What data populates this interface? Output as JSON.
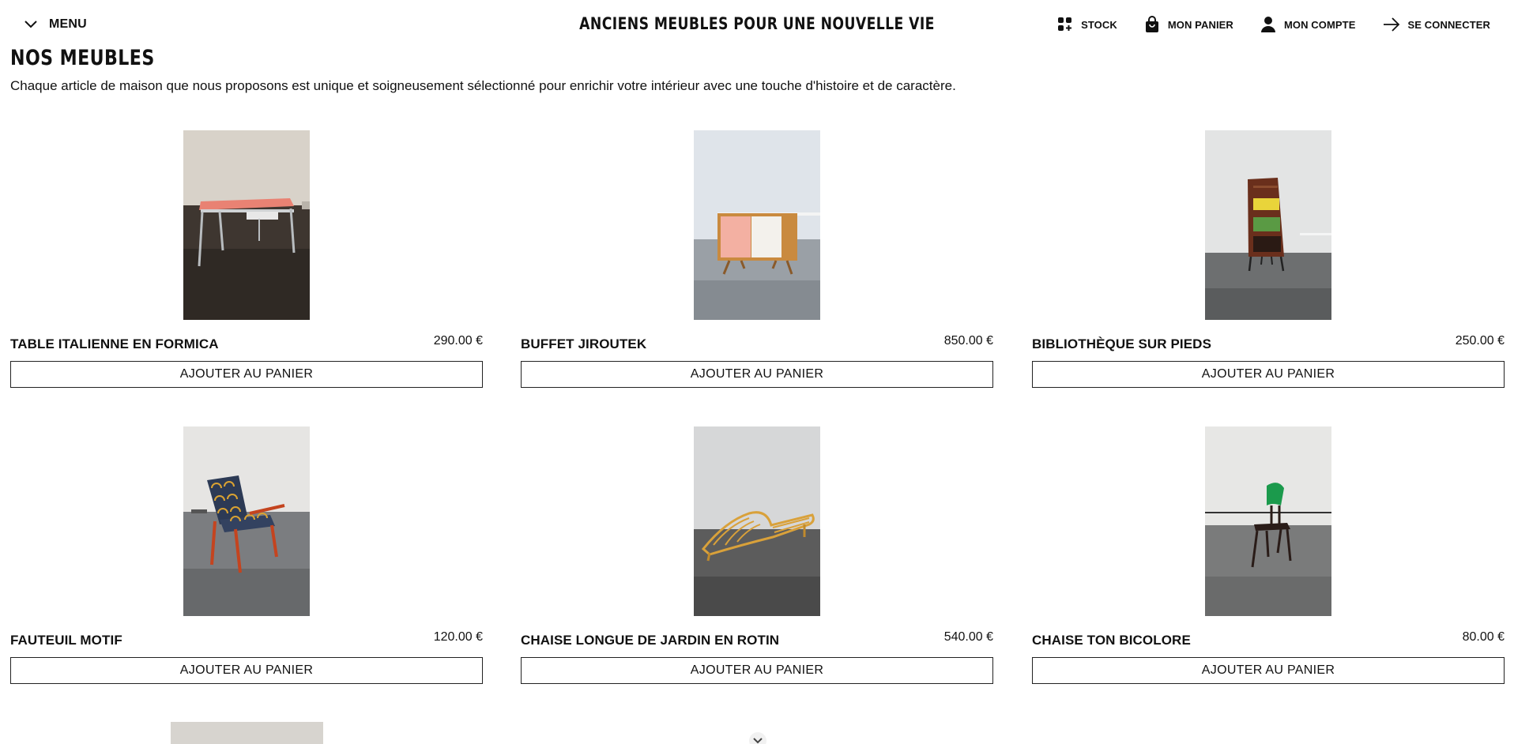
{
  "header": {
    "menu_label": "MENU",
    "site_title": "ANCIENS MEUBLES POUR UNE NOUVELLE VIE",
    "nav": {
      "stock": "STOCK",
      "cart": "MON PANIER",
      "account": "MON COMPTE",
      "login": "SE CONNECTER"
    }
  },
  "main": {
    "title": "NOS MEUBLES",
    "intro": "Chaque article de maison que nous proposons est unique et soigneusement sélectionné pour enrichir votre intérieur avec une touche d'histoire et de caractère."
  },
  "products": [
    {
      "name": "TABLE ITALIENNE EN FORMICA",
      "price": "290.00 €",
      "button": "AJOUTER AU PANIER",
      "image": "formica-desk-photo"
    },
    {
      "name": "BUFFET JIROUTEK",
      "price": "850.00 €",
      "button": "AJOUTER AU PANIER",
      "image": "sideboard-photo"
    },
    {
      "name": "BIBLIOTHÈQUE SUR PIEDS",
      "price": "250.00 €",
      "button": "AJOUTER AU PANIER",
      "image": "bookcase-photo"
    },
    {
      "name": "FAUTEUIL MOTIF",
      "price": "120.00 €",
      "button": "AJOUTER AU PANIER",
      "image": "armchair-photo"
    },
    {
      "name": "CHAISE LONGUE DE JARDIN EN ROTIN",
      "price": "540.00 €",
      "button": "AJOUTER AU PANIER",
      "image": "rattan-lounger-photo"
    },
    {
      "name": "CHAISE TON BICOLORE",
      "price": "80.00 €",
      "button": "AJOUTER AU PANIER",
      "image": "two-tone-chair-photo"
    }
  ],
  "icons": {
    "menu": "chevron-down-icon",
    "stock": "grid-plus-icon",
    "cart": "shopping-bag-icon",
    "account": "user-icon",
    "login": "arrow-right-icon",
    "scroll": "chevron-down-icon"
  }
}
